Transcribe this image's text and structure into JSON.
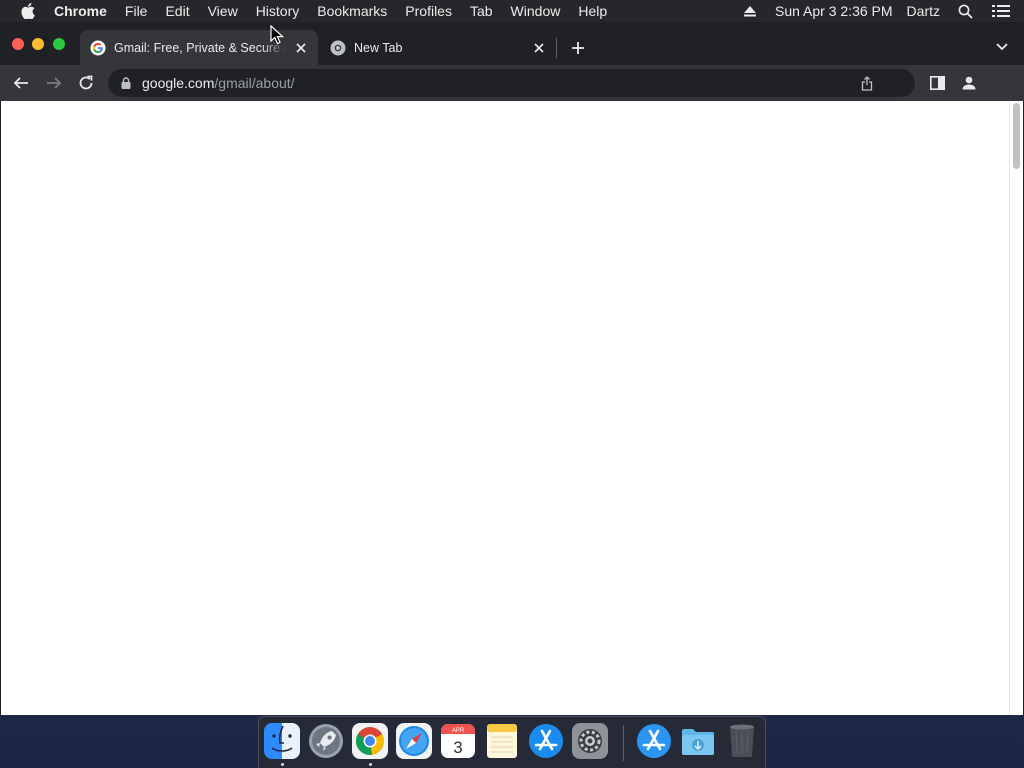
{
  "menubar": {
    "items": [
      "Chrome",
      "File",
      "Edit",
      "View",
      "History",
      "Bookmarks",
      "Profiles",
      "Tab",
      "Window",
      "Help"
    ],
    "date_time": "Sun Apr 3  2:36 PM",
    "user": "Dartz",
    "icons": [
      "apple-icon",
      "eject-icon",
      "spotlight-search-icon",
      "control-center-icon"
    ]
  },
  "browser": {
    "tabs": [
      {
        "title": "Gmail: Free, Private & Secure Email",
        "favicon": "google-g-icon",
        "active": true
      },
      {
        "title": "New Tab",
        "favicon": "chrome-icon",
        "active": false
      }
    ],
    "omnibox": {
      "host": "google.com",
      "path": "/gmail/about/"
    },
    "page": {
      "background": "#ffffff"
    }
  },
  "dock": {
    "apps": [
      {
        "name": "finder",
        "running": true
      },
      {
        "name": "launchpad",
        "running": false
      },
      {
        "name": "chrome",
        "running": true
      },
      {
        "name": "safari",
        "running": false
      },
      {
        "name": "calendar",
        "running": false,
        "month": "APR",
        "day": "3"
      },
      {
        "name": "notes",
        "running": false
      },
      {
        "name": "app-store",
        "running": false
      },
      {
        "name": "system-preferences",
        "running": false
      },
      {
        "name": "app-store-2",
        "running": false
      },
      {
        "name": "downloads-folder",
        "running": false
      },
      {
        "name": "trash",
        "running": false
      }
    ]
  },
  "colors": {
    "tab_active": "#35363a",
    "tab_strip": "#202124",
    "traffic_red": "#fe5f57",
    "traffic_yellow": "#febc2e",
    "traffic_green": "#28c840"
  }
}
